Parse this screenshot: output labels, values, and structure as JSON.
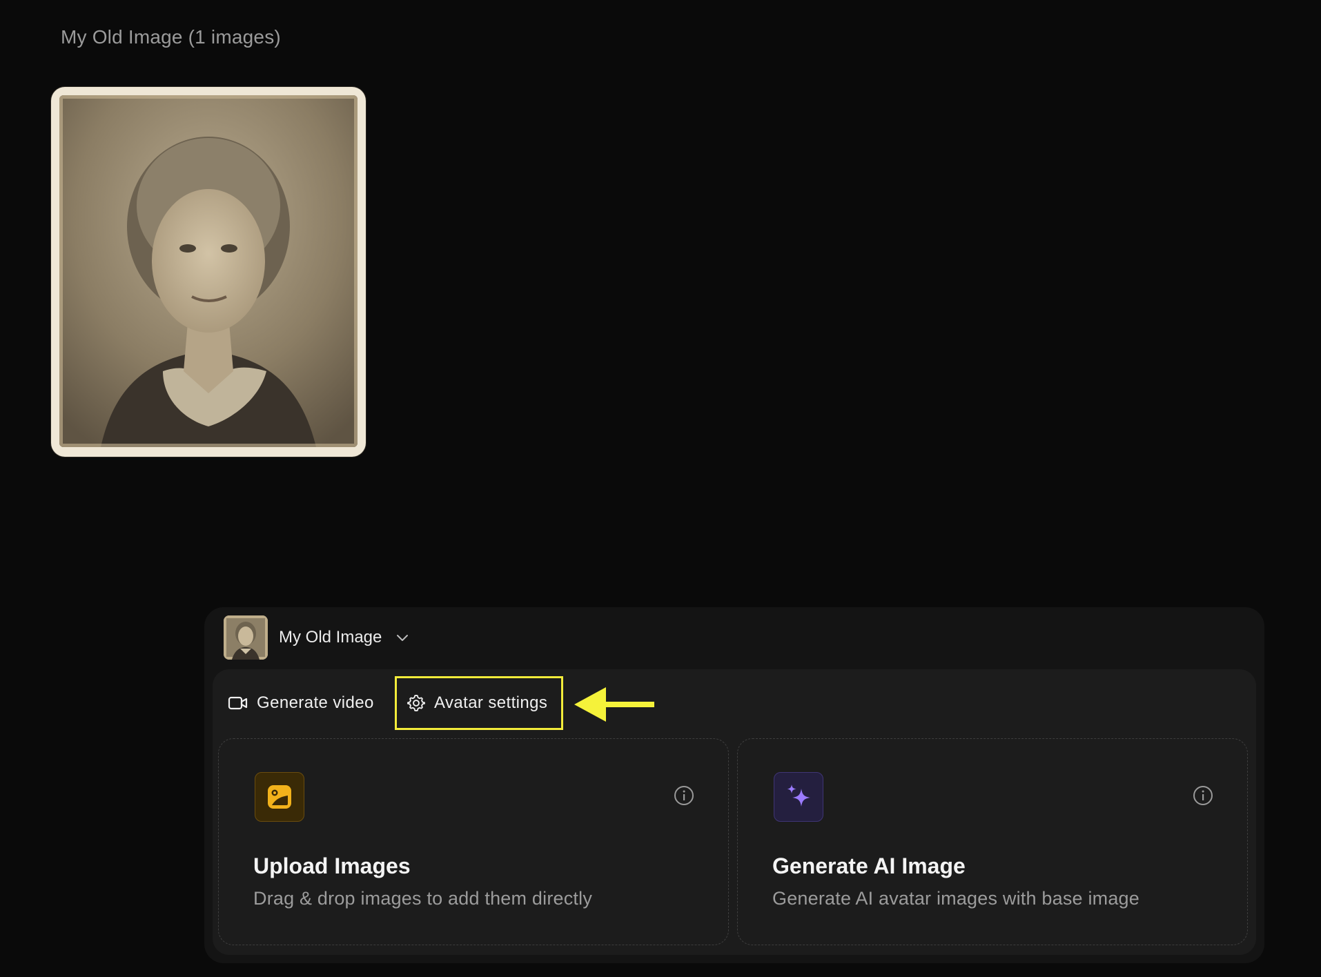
{
  "gallery": {
    "title": "My Old Image (1 images)"
  },
  "avatar": {
    "name": "My Old Image"
  },
  "toolbar": {
    "generate_video_label": "Generate video",
    "avatar_settings_label": "Avatar settings",
    "highlight_color": "#f3ec3a"
  },
  "cards": {
    "upload": {
      "title": "Upload Images",
      "description": "Drag & drop images to add them directly",
      "icon": "image-upload-icon",
      "accent": "#f2b21b"
    },
    "ai": {
      "title": "Generate AI Image",
      "description": "Generate AI avatar images with base image",
      "icon": "sparkles-icon",
      "accent": "#9b7bff"
    }
  }
}
